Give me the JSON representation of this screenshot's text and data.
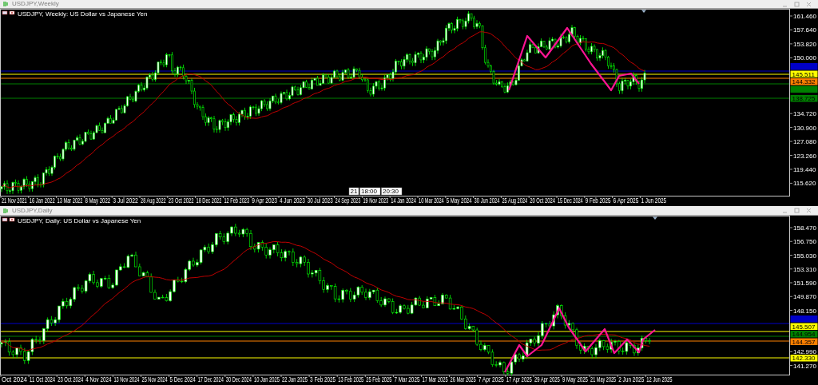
{
  "windows": [
    {
      "title": "USDJPY,Weekly",
      "header": "USDJPY, Weekly: US Dollar vs Japanese Yen",
      "y_ticks": [
        "161.460",
        "157.640",
        "153.820",
        "150.000",
        "134.720",
        "130.900",
        "127.080",
        "123.260",
        "119.440",
        "115.620"
      ],
      "x_ticks": [
        "21 Nov 2021",
        "16 Jan 2022",
        "13 Mar 2022",
        "8 May 2022",
        "3 Jul 2022",
        "28 Aug 2022",
        "23 Oct 2022",
        "18 Dec 2022",
        "12 Feb 2023",
        "9 Apr 2023",
        "4 Jun 2023",
        "30 Jul 2023",
        "24 Sep 2023",
        "19 Nov 2023",
        "14 Jan 2024",
        "10 Mar 2024",
        "5 May 2024",
        "30 Jun 2024",
        "25 Aug 2024",
        "20 Oct 2024",
        "15 Dec 2024",
        "9 Feb 2025",
        "6 Apr 2025",
        "1 Jun 2025"
      ],
      "price_levels": [
        {
          "color": "#0000c8"
        },
        {
          "color": "#ffff00",
          "label": "145.511"
        },
        {
          "color": "#ff8000",
          "label": "144.332"
        },
        {
          "color": "#008000"
        },
        {
          "color": "#008000",
          "label": "138.725"
        }
      ],
      "time_labels": [
        "21",
        "18:00",
        "20:30"
      ]
    },
    {
      "title": "USDJPY,Daily",
      "header": "USDJPY, Daily: US Dollar vs Japanese Yen",
      "y_ticks": [
        "158.470",
        "156.750",
        "155.030",
        "153.310",
        "151.590",
        "149.870",
        "148.150",
        "142.990",
        "141.270"
      ],
      "x_ticks": [
        "Oct 2024",
        "11 Oct 2024",
        "23 Oct 2024",
        "4 Nov 2024",
        "13 Nov 2024",
        "25 Nov 2024",
        "5 Dec 2024",
        "17 Dec 2024",
        "30 Dec 2024",
        "10 Jan 2025",
        "22 Jan 2025",
        "3 Feb 2025",
        "13 Feb 2025",
        "25 Feb 2025",
        "7 Mar 2025",
        "17 Mar 2025",
        "26 Mar 2025",
        "7 Apr 2025",
        "17 Apr 2025",
        "29 Apr 2025",
        "9 May 2025",
        "21 May 2025",
        "2 Jun 2025",
        "12 Jun 2025"
      ],
      "price_levels": [
        {
          "color": "#0000c8"
        },
        {
          "color": "#ffff00",
          "label": "145.507"
        },
        {
          "color": "#008000",
          "label": "144.954"
        },
        {
          "color": "#ff8000",
          "label": "144.357"
        },
        {
          "color": "#ffff00",
          "label": "142.330"
        }
      ]
    }
  ]
}
